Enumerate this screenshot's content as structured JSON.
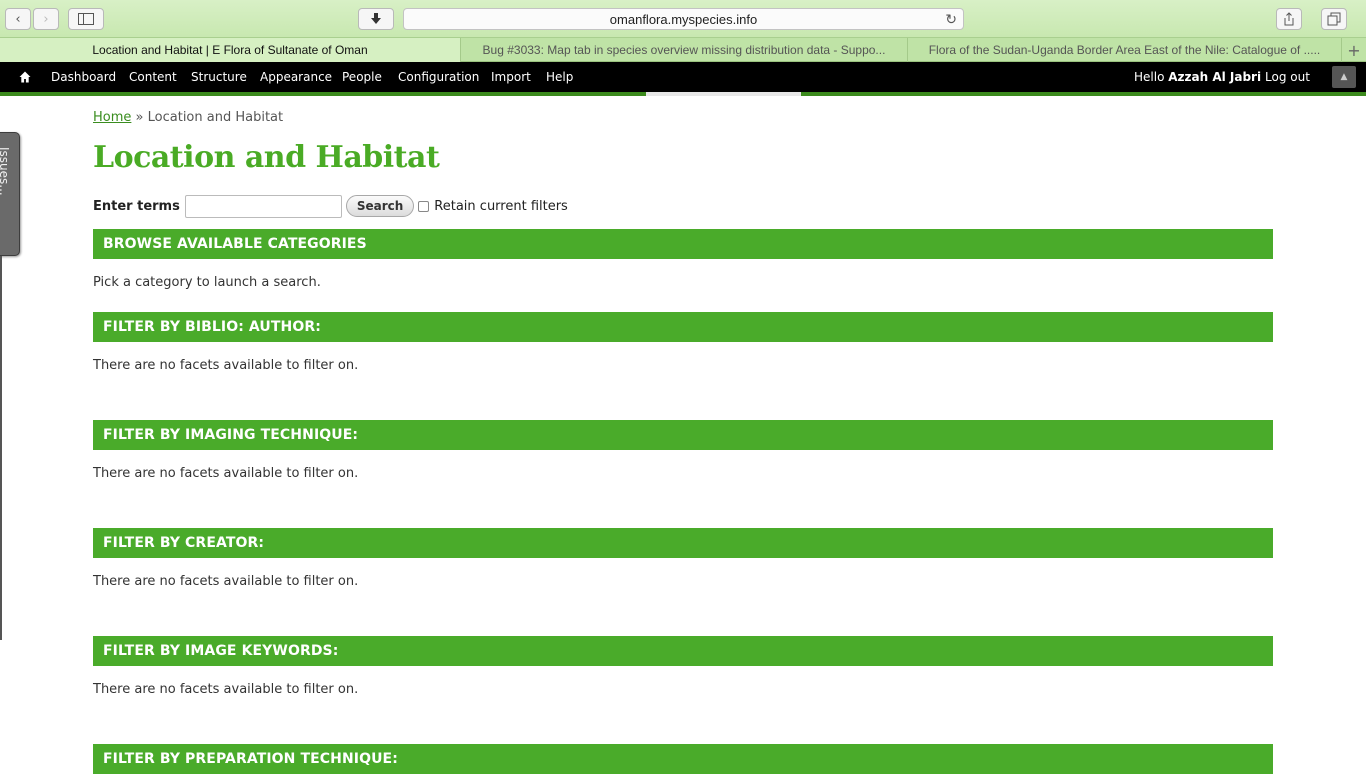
{
  "browser": {
    "url": "omanflora.myspecies.info",
    "tabs": [
      {
        "title": "Location and Habitat | E Flora of Sultanate of Oman"
      },
      {
        "title": "Bug #3033: Map tab in species overview missing distribution data - Suppo..."
      },
      {
        "title": "Flora of the Sudan-Uganda Border Area East of the Nile: Catalogue of ....."
      }
    ]
  },
  "admin": {
    "menu": [
      {
        "label": "Dashboard"
      },
      {
        "label": "Content"
      },
      {
        "label": "Structure"
      },
      {
        "label": "Appearance"
      },
      {
        "label": "People"
      },
      {
        "label": "Configuration"
      },
      {
        "label": "Import"
      },
      {
        "label": "Help"
      }
    ],
    "greeting": "Hello",
    "username": "Azzah Al Jabri",
    "logout": "Log out"
  },
  "issues_tab": {
    "label": "Issues..."
  },
  "breadcrumb": {
    "home": "Home",
    "separator": "»",
    "current": "Location and Habitat"
  },
  "page_title": "Location and Habitat",
  "search": {
    "label": "Enter terms",
    "value": "",
    "button": "Search",
    "retain_label": "Retain current filters",
    "retain_checked": false
  },
  "sections": [
    {
      "header": "BROWSE AVAILABLE CATEGORIES",
      "text": "Pick a category to launch a search."
    },
    {
      "header": "FILTER BY BIBLIO: AUTHOR:",
      "text": "There are no facets available to filter on."
    },
    {
      "header": "FILTER BY IMAGING TECHNIQUE:",
      "text": "There are no facets available to filter on."
    },
    {
      "header": "FILTER BY CREATOR:",
      "text": "There are no facets available to filter on."
    },
    {
      "header": "FILTER BY IMAGE KEYWORDS:",
      "text": "There are no facets available to filter on."
    },
    {
      "header": "FILTER BY PREPARATION TECHNIQUE:",
      "text": ""
    }
  ],
  "colors": {
    "accent": "#4aab2a",
    "admin_bg": "#000000",
    "title": "#4aab25"
  }
}
